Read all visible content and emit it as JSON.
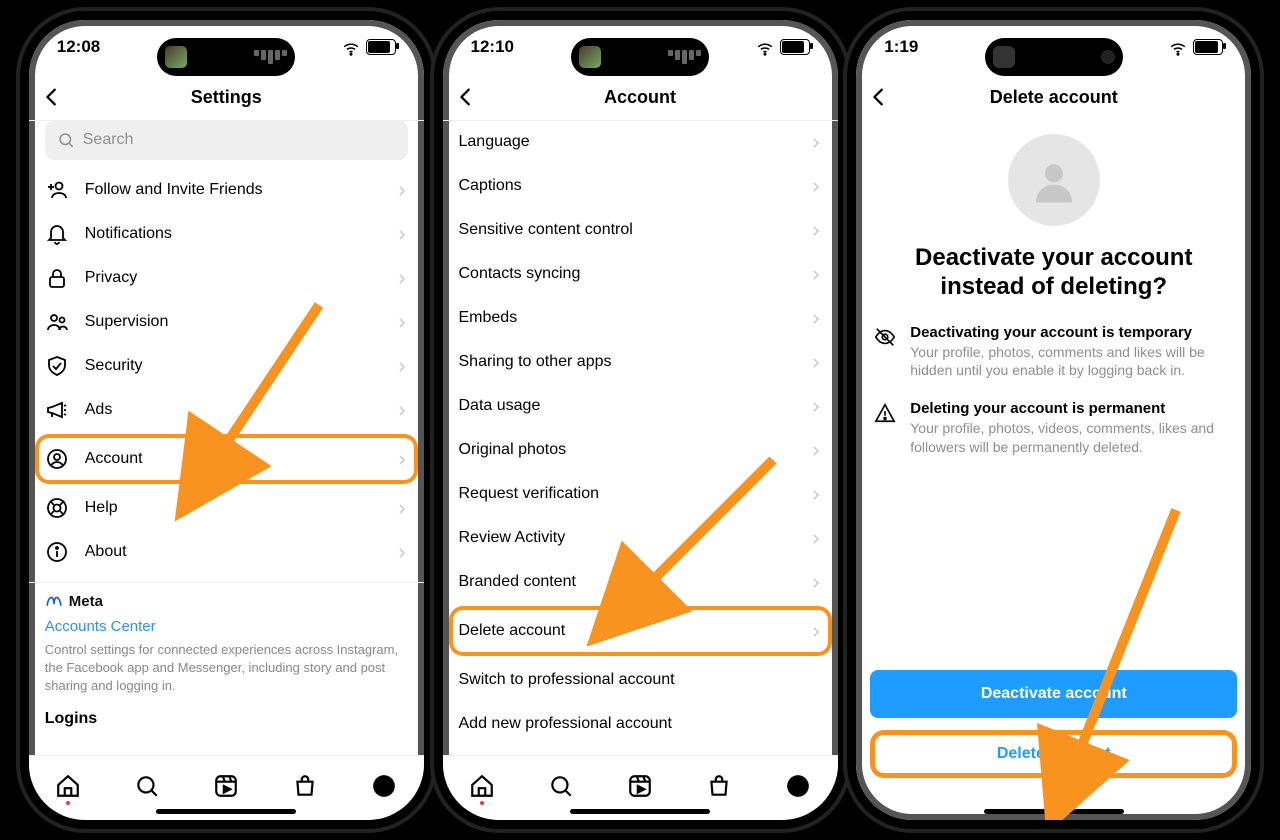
{
  "phone1": {
    "time": "12:08",
    "title": "Settings",
    "search_placeholder": "Search",
    "items": [
      {
        "label": "Follow and Invite Friends"
      },
      {
        "label": "Notifications"
      },
      {
        "label": "Privacy"
      },
      {
        "label": "Supervision"
      },
      {
        "label": "Security"
      },
      {
        "label": "Ads"
      },
      {
        "label": "Account"
      },
      {
        "label": "Help"
      },
      {
        "label": "About"
      }
    ],
    "meta_brand": "Meta",
    "meta_link": "Accounts Center",
    "meta_desc": "Control settings for connected experiences across Instagram, the Facebook app and Messenger, including story and post sharing and logging in.",
    "logins": "Logins"
  },
  "phone2": {
    "time": "12:10",
    "title": "Account",
    "items": [
      {
        "label": "Language"
      },
      {
        "label": "Captions"
      },
      {
        "label": "Sensitive content control"
      },
      {
        "label": "Contacts syncing"
      },
      {
        "label": "Embeds"
      },
      {
        "label": "Sharing to other apps"
      },
      {
        "label": "Data usage"
      },
      {
        "label": "Original photos"
      },
      {
        "label": "Request verification"
      },
      {
        "label": "Review Activity"
      },
      {
        "label": "Branded content"
      },
      {
        "label": "Delete account"
      }
    ],
    "links": [
      "Switch to professional account",
      "Add new professional account"
    ]
  },
  "phone3": {
    "time": "1:19",
    "title": "Delete account",
    "heading": "Deactivate your account instead of deleting?",
    "info1_title": "Deactivating your account is temporary",
    "info1_desc": "Your profile, photos, comments and likes will be hidden until you enable it by logging back in.",
    "info2_title": "Deleting your account is permanent",
    "info2_desc": "Your profile, photos, videos, comments, likes and followers will be permanently deleted.",
    "btn_primary": "Deactivate account",
    "btn_secondary": "Delete account"
  }
}
